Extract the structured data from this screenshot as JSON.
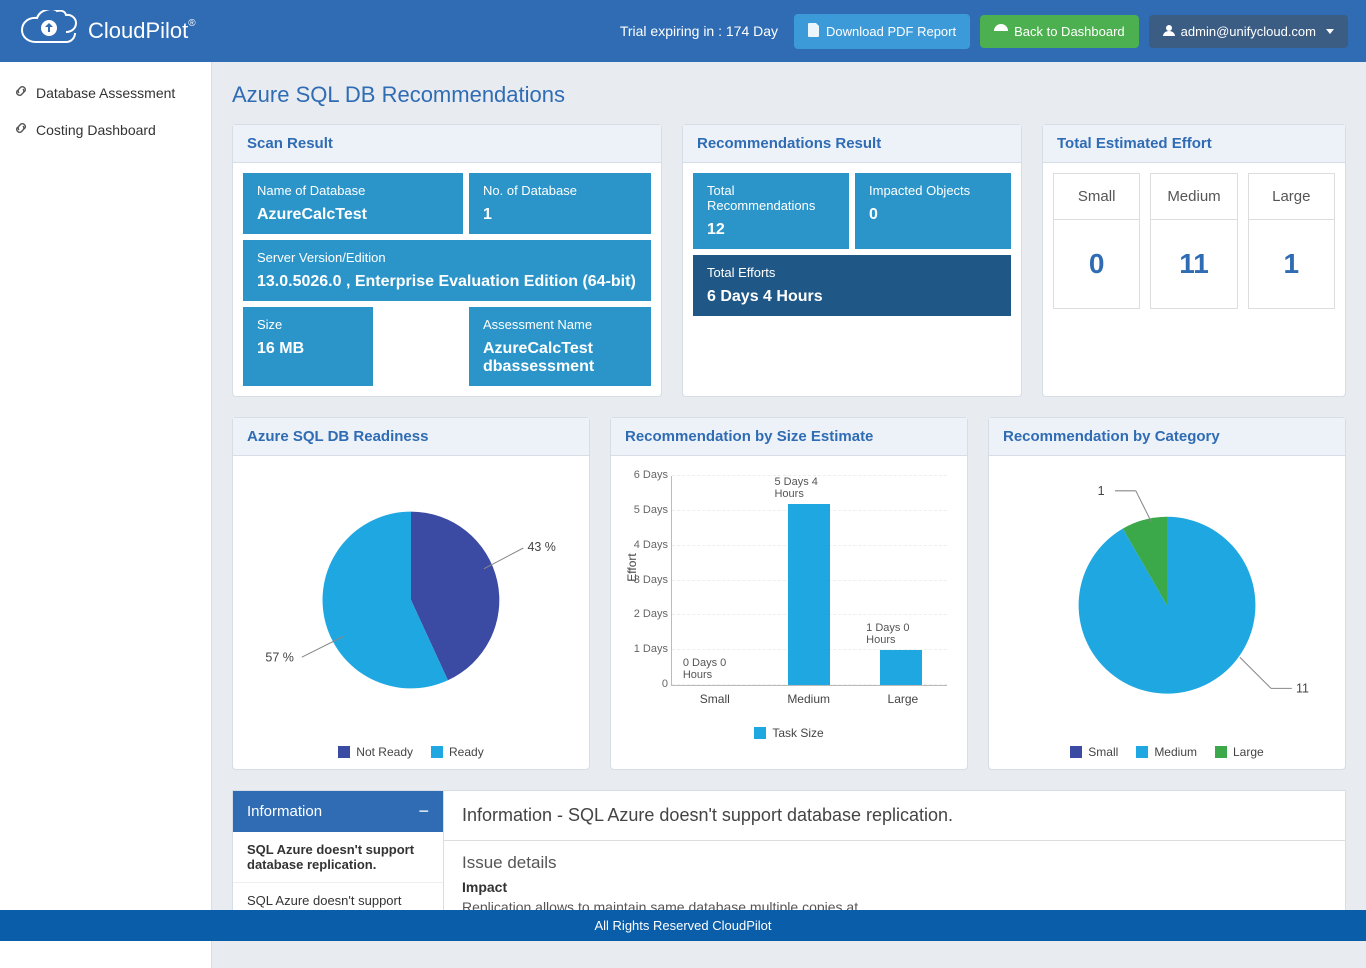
{
  "header": {
    "brand": "CloudPilot",
    "trial_text": "Trial expiring in : 174 Day",
    "download_btn": "Download PDF Report",
    "dashboard_btn": "Back to Dashboard",
    "user_label": "admin@unifycloud.com"
  },
  "sidebar": {
    "items": [
      "Database Assessment",
      "Costing Dashboard"
    ]
  },
  "page_title": "Azure SQL DB Recommendations",
  "scan": {
    "panel_title": "Scan Result",
    "name_label": "Name of Database",
    "name_value": "AzureCalcTest",
    "count_label": "No. of Database",
    "count_value": "1",
    "server_label": "Server Version/Edition",
    "server_value": "13.0.5026.0 , Enterprise Evaluation Edition (64-bit)",
    "size_label": "Size",
    "size_value": "16 MB",
    "assess_label": "Assessment Name",
    "assess_value": "AzureCalcTest dbassessment"
  },
  "recs": {
    "panel_title": "Recommendations Result",
    "total_label": "Total Recommendations",
    "total_value": "12",
    "impacted_label": "Impacted Objects",
    "impacted_value": "0",
    "efforts_label": "Total Efforts",
    "efforts_value": "6 Days 4 Hours"
  },
  "effort": {
    "panel_title": "Total Estimated Effort",
    "cols": [
      {
        "label": "Small",
        "value": "0"
      },
      {
        "label": "Medium",
        "value": "11"
      },
      {
        "label": "Large",
        "value": "1"
      }
    ]
  },
  "charts": {
    "readiness": {
      "title": "Azure SQL DB Readiness",
      "not_ready_label": "Not Ready",
      "ready_label": "Ready",
      "not_ready_pct": "43 %",
      "ready_pct": "57 %"
    },
    "size": {
      "title": "Recommendation by Size Estimate",
      "ylabel": "Effort",
      "xlabel": "Task Size",
      "yticks": [
        "0",
        "1 Days",
        "2 Days",
        "3 Days",
        "4 Days",
        "5 Days",
        "6 Days"
      ],
      "bars": [
        {
          "label": "Small",
          "top": "0 Days 0 Hours"
        },
        {
          "label": "Medium",
          "top": "5 Days 4 Hours"
        },
        {
          "label": "Large",
          "top": "1 Days 0 Hours"
        }
      ]
    },
    "category": {
      "title": "Recommendation by Category",
      "legend": {
        "small": "Small",
        "medium": "Medium",
        "large": "Large"
      },
      "label_1": "1",
      "label_11": "11"
    }
  },
  "info": {
    "side_title": "Information",
    "list": [
      "SQL Azure doesn't support database replication.",
      "SQL Azure doesn't support"
    ],
    "main_title": "Information - SQL Azure doesn't support database replication.",
    "issue_heading": "Issue details",
    "impact_label": "Impact",
    "impact_text": "Replication allows to maintain same database multiple copies at"
  },
  "footer": "All Rights Reserved CloudPilot",
  "chart_data": [
    {
      "type": "pie",
      "title": "Azure SQL DB Readiness",
      "series": [
        {
          "name": "Not Ready",
          "value": 43,
          "color": "#3b4aa3"
        },
        {
          "name": "Ready",
          "value": 57,
          "color": "#1ea7e0"
        }
      ]
    },
    {
      "type": "bar",
      "title": "Recommendation by Size Estimate",
      "xlabel": "Task Size",
      "ylabel": "Effort",
      "categories": [
        "Small",
        "Medium",
        "Large"
      ],
      "values_days": [
        0,
        5.17,
        1
      ],
      "value_labels": [
        "0 Days 0 Hours",
        "5 Days 4 Hours",
        "1 Days 0 Hours"
      ],
      "ylim": [
        0,
        6
      ]
    },
    {
      "type": "pie",
      "title": "Recommendation by Category",
      "series": [
        {
          "name": "Small",
          "value": 0,
          "color": "#3b4aa3"
        },
        {
          "name": "Medium",
          "value": 11,
          "color": "#1ea7e0"
        },
        {
          "name": "Large",
          "value": 1,
          "color": "#3ba84a"
        }
      ]
    }
  ]
}
